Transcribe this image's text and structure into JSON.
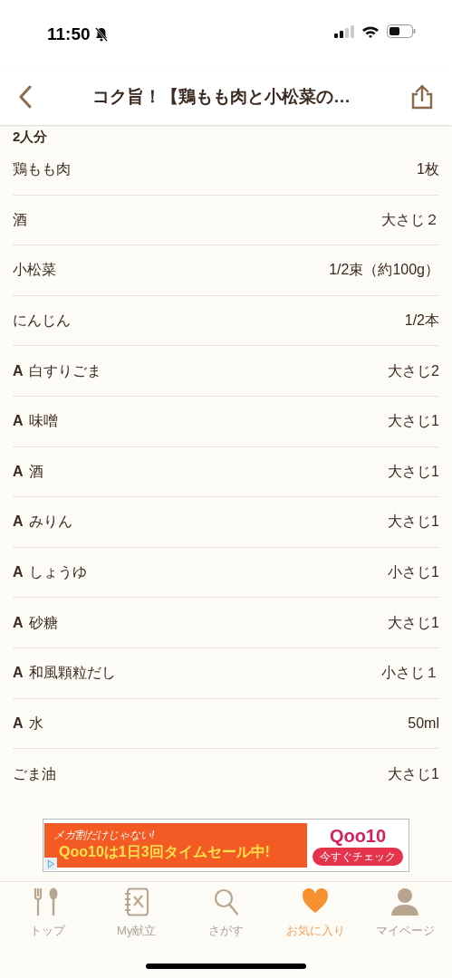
{
  "status_bar": {
    "time": "11:50"
  },
  "header": {
    "title": "コク旨！【鶏もも肉と小松菜の…"
  },
  "servings": "2人分",
  "ingredients": [
    {
      "name": "鶏もも肉",
      "amount": "1枚"
    },
    {
      "name": "酒",
      "amount": "大さじ２"
    },
    {
      "name": "小松菜",
      "amount": "1/2束（約100g）"
    },
    {
      "name": "にんじん",
      "amount": "1/2本"
    },
    {
      "group": "A",
      "name": "白すりごま",
      "amount": "大さじ2"
    },
    {
      "group": "A",
      "name": "味噌",
      "amount": "大さじ1"
    },
    {
      "group": "A",
      "name": "酒",
      "amount": "大さじ1"
    },
    {
      "group": "A",
      "name": "みりん",
      "amount": "大さじ1"
    },
    {
      "group": "A",
      "name": "しょうゆ",
      "amount": "小さじ1"
    },
    {
      "group": "A",
      "name": "砂糖",
      "amount": "大さじ1"
    },
    {
      "group": "A",
      "name": "和風顆粒だし",
      "amount": "小さじ１"
    },
    {
      "group": "A",
      "name": "水",
      "amount": "50ml"
    },
    {
      "name": "ごま油",
      "amount": "大さじ1"
    }
  ],
  "ad": {
    "tagline": "メガ割だけじゃない!",
    "headline": "Qoo10は1日3回タイムセール中!",
    "brand": "Qoo10",
    "cta": "今すぐチェック"
  },
  "tabs": [
    {
      "kind": "cutlery",
      "label": "トップ",
      "selected": false
    },
    {
      "kind": "notebook",
      "label": "My献立",
      "selected": false
    },
    {
      "kind": "search",
      "label": "さがす",
      "selected": false
    },
    {
      "kind": "heart",
      "label": "お気に入り",
      "selected": true
    },
    {
      "kind": "person",
      "label": "マイページ",
      "selected": false
    }
  ]
}
